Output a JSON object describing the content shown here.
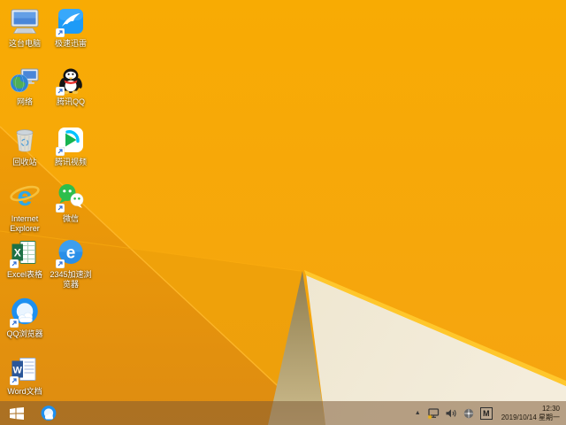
{
  "desktop": {
    "icons": [
      {
        "label": "这台电脑"
      },
      {
        "label": "极速迅雷"
      },
      {
        "label": "网络"
      },
      {
        "label": "腾讯QQ"
      },
      {
        "label": "回收站"
      },
      {
        "label": "腾讯视频"
      },
      {
        "label": "Internet Explorer"
      },
      {
        "label": "微信"
      },
      {
        "label": "Excel表格"
      },
      {
        "label": "2345加速浏览器"
      },
      {
        "label": "QQ浏览器"
      },
      {
        "label": "Word文档"
      }
    ]
  },
  "taskbar": {
    "pinned": [
      {
        "name": "qq-browser"
      }
    ],
    "tray": {
      "hidden_icons_glyph": "▲",
      "ime_label": "M",
      "time": "12:30",
      "date": "2019/10/14 星期一"
    }
  },
  "colors": {
    "wallpaper_base": "#F7A80A",
    "wallpaper_dark_facet": "#E6930C",
    "wallpaper_tan_shadow": "#A8956A",
    "wallpaper_cream": "#F0E8D4",
    "wallpaper_fold_edge": "#FFC72C",
    "taskbar_background": "rgba(125,88,52,0.52)",
    "icon_label_text": "#FFFFFF",
    "clock_text": "#221B10"
  }
}
